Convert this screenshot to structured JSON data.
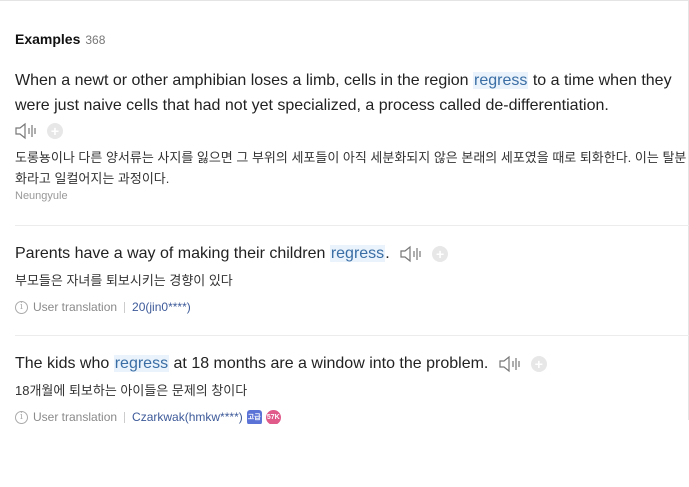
{
  "header": {
    "title": "Examples",
    "count": "368"
  },
  "examples": [
    {
      "pre": "When a newt or other amphibian loses a limb, cells in the region ",
      "keyword": "regress",
      "post": " to a time when they were just naive cells that had not yet specialized, a process called de-differentiation.",
      "translation": "도롱뇽이나 다른 양서류는 사지를 잃으면 그 부위의 세포들이 아직 세분화되지 않은 본래의 세포였을 때로 퇴화한다. 이는 탈분화라고 일컬어지는 과정이다.",
      "source": "Neungyule"
    },
    {
      "pre": "Parents have a way of making their children ",
      "keyword": "regress",
      "post": ".",
      "translation": "부모들은 자녀를 퇴보시키는 경향이 있다",
      "meta_label": "User translation",
      "user": "20(jin0****)"
    },
    {
      "pre": "The kids who ",
      "keyword": "regress",
      "post": " at 18 months are a window into the problem.",
      "translation": "18개월에 퇴보하는 아이들은 문제의 창이다",
      "meta_label": "User translation",
      "user": "Czarkwak(hmkw****)",
      "badge_level": "고급",
      "badge_points": "57K"
    }
  ],
  "icons": {
    "speaker": "speaker-icon",
    "add": "plus-icon",
    "info": "info-icon"
  },
  "colors": {
    "highlight_bg": "#eaf3fb",
    "highlight_text": "#3a6ea5",
    "user_link": "#3d5a99"
  }
}
